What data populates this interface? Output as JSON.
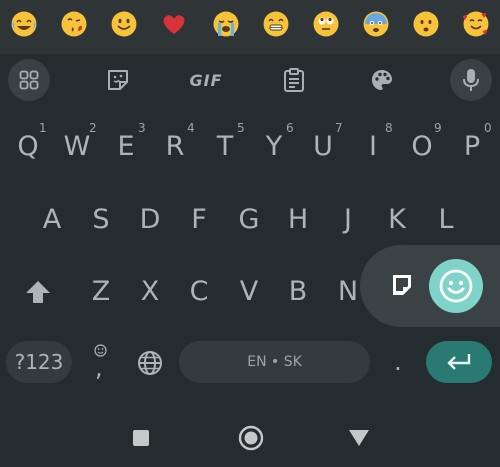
{
  "emoji_row": {
    "items": [
      {
        "name": "face-with-tears-of-joy-icon"
      },
      {
        "name": "face-blowing-kiss-icon"
      },
      {
        "name": "smiling-face-icon"
      },
      {
        "name": "red-heart-icon"
      },
      {
        "name": "loudly-crying-face-icon"
      },
      {
        "name": "grinning-face-icon"
      },
      {
        "name": "face-with-rolling-eyes-icon"
      },
      {
        "name": "anxious-face-icon"
      },
      {
        "name": "frowning-face-icon"
      },
      {
        "name": "smiling-face-with-hearts-icon"
      }
    ]
  },
  "toolbar": {
    "gif_label": "GIF",
    "icons": [
      "apps-grid-icon",
      "sticker-icon",
      "gif-button",
      "clipboard-icon",
      "palette-icon",
      "microphone-icon"
    ]
  },
  "keyboard": {
    "row1": [
      {
        "label": "Q",
        "hint": "1"
      },
      {
        "label": "W",
        "hint": "2"
      },
      {
        "label": "E",
        "hint": "3"
      },
      {
        "label": "R",
        "hint": "4"
      },
      {
        "label": "T",
        "hint": "5"
      },
      {
        "label": "Y",
        "hint": "6"
      },
      {
        "label": "U",
        "hint": "7"
      },
      {
        "label": "I",
        "hint": "8"
      },
      {
        "label": "O",
        "hint": "9"
      },
      {
        "label": "P",
        "hint": "0"
      }
    ],
    "row2": [
      "A",
      "S",
      "D",
      "F",
      "G",
      "H",
      "J",
      "K",
      "L"
    ],
    "row3": [
      "Z",
      "X",
      "C",
      "V",
      "B",
      "N"
    ],
    "symbols_label": "?123",
    "comma_label": ",",
    "space_label": "EN • SK",
    "period_label": "."
  },
  "colors": {
    "background": "#252c30",
    "emoji_bar": "#2f3437",
    "accent": "#2a7a74",
    "popup_emoji": "#7fd3c8"
  }
}
